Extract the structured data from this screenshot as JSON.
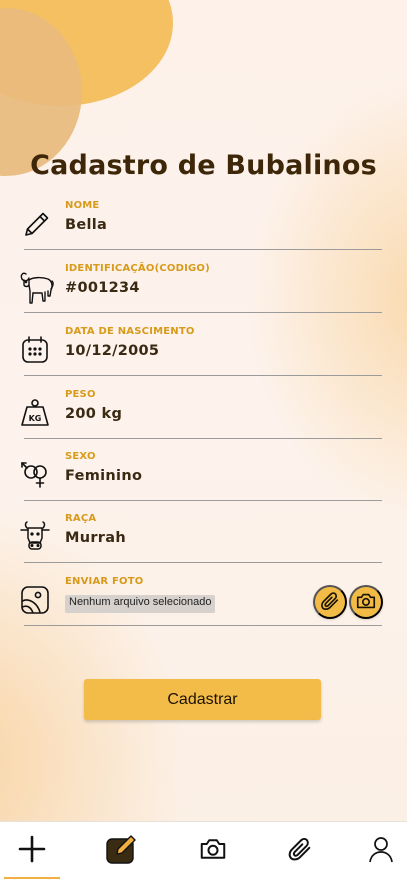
{
  "page": {
    "title": "Cadastro de Bubalinos"
  },
  "fields": {
    "nome": {
      "label": "NOME",
      "value": "Bella",
      "icon": "pencil-icon"
    },
    "identificacao": {
      "label": "IDENTIFICAÇÃO(CODIGO)",
      "value": "#001234",
      "icon": "buffalo-icon"
    },
    "nascimento": {
      "label": "DATA DE NASCIMENTO",
      "value": "10/12/2005",
      "icon": "calendar-icon"
    },
    "peso": {
      "label": "PESO",
      "value": "200 kg",
      "icon": "weight-kg-icon"
    },
    "sexo": {
      "label": "SEXO",
      "value": "Feminino",
      "icon": "gender-icon"
    },
    "raca": {
      "label": "RAÇA",
      "value": "Murrah",
      "icon": "cow-head-icon"
    },
    "foto": {
      "label": "ENVIAR FOTO",
      "file_status": "Nenhum arquivo selecionado",
      "icon": "image-icon"
    }
  },
  "actions": {
    "submit_label": "Cadastrar"
  },
  "tabbar": {
    "items": [
      {
        "name": "add",
        "icon": "plus-icon",
        "active": true
      },
      {
        "name": "edit",
        "icon": "edit-note-icon",
        "active": false
      },
      {
        "name": "camera",
        "icon": "camera-icon",
        "active": false
      },
      {
        "name": "attach",
        "icon": "paperclip-icon",
        "active": false
      },
      {
        "name": "profile",
        "icon": "user-icon",
        "active": false
      }
    ]
  },
  "colors": {
    "accent": "#f3bc48",
    "label": "#d89a1a",
    "title": "#3d2708",
    "blob": "#f4c062"
  }
}
